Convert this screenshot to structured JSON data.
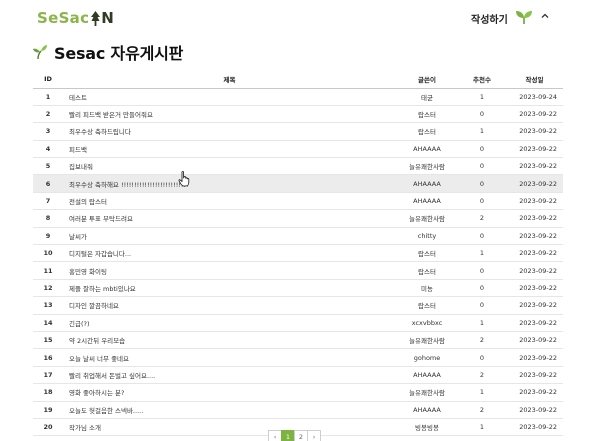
{
  "header": {
    "logo_part1": "SeSac",
    "logo_part2": "N",
    "write_label": "작성하기",
    "profile_icon": "sprout-icon",
    "caret_icon": "chevron-up-icon"
  },
  "page": {
    "title": "Sesac 자유게시판"
  },
  "table": {
    "columns": {
      "id": "ID",
      "title": "제목",
      "author": "글쓴이",
      "recommend": "추천수",
      "date": "작성일"
    },
    "rows": [
      {
        "id": "1",
        "title": "테스트",
        "author": "태균",
        "recommend": "1",
        "date": "2023-09-24"
      },
      {
        "id": "2",
        "title": "빨리 피드백 받은거 만들어줘요",
        "author": "랍스터",
        "recommend": "0",
        "date": "2023-09-22"
      },
      {
        "id": "3",
        "title": "최우수상 축하드립니다",
        "author": "랍스터",
        "recommend": "1",
        "date": "2023-09-22"
      },
      {
        "id": "4",
        "title": "피드백",
        "author": "AHAAAA",
        "recommend": "0",
        "date": "2023-09-22"
      },
      {
        "id": "5",
        "title": "집보내줘",
        "author": "늘유쾌한사람",
        "recommend": "0",
        "date": "2023-09-22"
      },
      {
        "id": "6",
        "title": "최우수상 축하해요 !!!!!!!!!!!!!!!!!!!!!!!!!!",
        "author": "AHAAAA",
        "recommend": "0",
        "date": "2023-09-22"
      },
      {
        "id": "7",
        "title": "전설의 랍스터",
        "author": "AHAAAA",
        "recommend": "0",
        "date": "2023-09-22"
      },
      {
        "id": "8",
        "title": "여러분 투표 부탁드려요",
        "author": "늘유쾌한사람",
        "recommend": "2",
        "date": "2023-09-22"
      },
      {
        "id": "9",
        "title": "날씨가",
        "author": "chitty",
        "recommend": "0",
        "date": "2023-09-22"
      },
      {
        "id": "10",
        "title": "디지털은 자갑습니다...",
        "author": "랍스터",
        "recommend": "1",
        "date": "2023-09-22"
      },
      {
        "id": "11",
        "title": "홍민영 화이팅",
        "author": "랍스터",
        "recommend": "0",
        "date": "2023-09-22"
      },
      {
        "id": "12",
        "title": "제플 잘하는 mbti있나요",
        "author": "미뇽",
        "recommend": "0",
        "date": "2023-09-22"
      },
      {
        "id": "13",
        "title": "디자인 깔끔하네요",
        "author": "랍스터",
        "recommend": "0",
        "date": "2023-09-22"
      },
      {
        "id": "14",
        "title": "긴급(?)",
        "author": "xcxvbbxc",
        "recommend": "1",
        "date": "2023-09-22"
      },
      {
        "id": "15",
        "title": "약 2시간뒤 우리모습",
        "author": "늘유쾌한사람",
        "recommend": "2",
        "date": "2023-09-22"
      },
      {
        "id": "16",
        "title": "오늘 날씨 너무 좋네요",
        "author": "gohome",
        "recommend": "0",
        "date": "2023-09-22"
      },
      {
        "id": "17",
        "title": "빨리 취업해서 돈벌고 싶어요....",
        "author": "AHAAAA",
        "recommend": "2",
        "date": "2023-09-22"
      },
      {
        "id": "18",
        "title": "영화 좋아하시는 분?",
        "author": "늘유쾌한사람",
        "recommend": "1",
        "date": "2023-09-22"
      },
      {
        "id": "19",
        "title": "오늘도 헛걸음한 스넥바.....",
        "author": "AHAAAA",
        "recommend": "2",
        "date": "2023-09-22"
      },
      {
        "id": "20",
        "title": "작가님 소개",
        "author": "빙봉빙봉",
        "recommend": "1",
        "date": "2023-09-22"
      }
    ]
  },
  "pagination": {
    "prev": "‹",
    "pages": [
      "1",
      "2"
    ],
    "active": "1",
    "next": "›"
  },
  "colors": {
    "brand_green": "#8bb44a",
    "active_page": "#7cb342",
    "row_highlight": "#ececec"
  }
}
